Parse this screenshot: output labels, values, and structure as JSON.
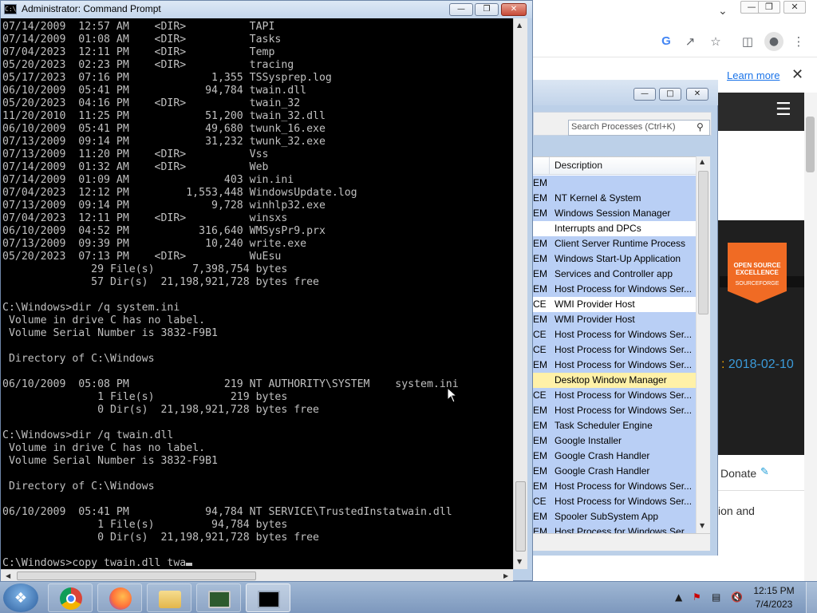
{
  "cmd_window": {
    "title": "Administrator: Command Prompt",
    "icon": "C:\\",
    "console_lines": [
      "07/14/2009  12:57 AM    <DIR>          TAPI",
      "07/14/2009  01:08 AM    <DIR>          Tasks",
      "07/04/2023  12:11 PM    <DIR>          Temp",
      "05/20/2023  02:23 PM    <DIR>          tracing",
      "05/17/2023  07:16 PM             1,355 TSSysprep.log",
      "06/10/2009  05:41 PM            94,784 twain.dll",
      "05/20/2023  04:16 PM    <DIR>          twain_32",
      "11/20/2010  11:25 PM            51,200 twain_32.dll",
      "06/10/2009  05:41 PM            49,680 twunk_16.exe",
      "07/13/2009  09:14 PM            31,232 twunk_32.exe",
      "07/13/2009  11:20 PM    <DIR>          Vss",
      "07/14/2009  01:32 AM    <DIR>          Web",
      "07/14/2009  01:09 AM               403 win.ini",
      "07/04/2023  12:12 PM         1,553,448 WindowsUpdate.log",
      "07/13/2009  09:14 PM             9,728 winhlp32.exe",
      "07/04/2023  12:11 PM    <DIR>          winsxs",
      "06/10/2009  04:52 PM           316,640 WMSysPr9.prx",
      "07/13/2009  09:39 PM            10,240 write.exe",
      "05/20/2023  07:13 PM    <DIR>          WuEsu",
      "              29 File(s)      7,398,754 bytes",
      "              57 Dir(s)  21,198,921,728 bytes free",
      "",
      "C:\\Windows>dir /q system.ini",
      " Volume in drive C has no label.",
      " Volume Serial Number is 3832-F9B1",
      "",
      " Directory of C:\\Windows",
      "",
      "06/10/2009  05:08 PM               219 NT AUTHORITY\\SYSTEM    system.ini",
      "               1 File(s)            219 bytes",
      "               0 Dir(s)  21,198,921,728 bytes free",
      "",
      "C:\\Windows>dir /q twain.dll",
      " Volume in drive C has no label.",
      " Volume Serial Number is 3832-F9B1",
      "",
      " Directory of C:\\Windows",
      "",
      "06/10/2009  05:41 PM            94,784 NT SERVICE\\TrustedInstatwain.dll",
      "               1 File(s)         94,784 bytes",
      "               0 Dir(s)  21,198,921,728 bytes free",
      "",
      "C:\\Windows>copy twain.dll twa"
    ]
  },
  "chrome": {
    "learn_more": "Learn more",
    "badge_line1": "OPEN SOURCE",
    "badge_line2": "EXCELLENCE",
    "badge_sf": "SOURCEFORGE",
    "date_text": "2018-02-10",
    "donate": "Donate",
    "ion_and": "ion and",
    "google_g": "G"
  },
  "procexp": {
    "search_placeholder": "Search Processes (Ctrl+K)",
    "column_description": "Description",
    "colors": {
      "blue": "#b9cff5",
      "pink": "#f1c6ea",
      "yellow": "#fff1a8",
      "white": "#ffffff"
    },
    "rows": [
      {
        "pfx": "EM",
        "desc": "",
        "color": "blue"
      },
      {
        "pfx": "EM",
        "desc": "NT Kernel & System",
        "color": "blue"
      },
      {
        "pfx": "EM",
        "desc": "Windows Session Manager",
        "color": "blue"
      },
      {
        "pfx": "",
        "desc": "Interrupts and DPCs",
        "color": "white"
      },
      {
        "pfx": "EM",
        "desc": "Client Server Runtime Process",
        "color": "blue"
      },
      {
        "pfx": "EM",
        "desc": "Windows Start-Up Application",
        "color": "blue"
      },
      {
        "pfx": "EM",
        "desc": "Services and Controller app",
        "color": "blue"
      },
      {
        "pfx": "EM",
        "desc": "Host Process for Windows Ser...",
        "color": "blue"
      },
      {
        "pfx": "CE",
        "desc": "WMI Provider Host",
        "color": "white"
      },
      {
        "pfx": "EM",
        "desc": "WMI Provider Host",
        "color": "blue"
      },
      {
        "pfx": "CE",
        "desc": "Host Process for Windows Ser...",
        "color": "blue"
      },
      {
        "pfx": "CE",
        "desc": "Host Process for Windows Ser...",
        "color": "blue"
      },
      {
        "pfx": "EM",
        "desc": "Host Process for Windows Ser...",
        "color": "blue"
      },
      {
        "pfx": "",
        "desc": "Desktop Window Manager",
        "color": "yellow"
      },
      {
        "pfx": "CE",
        "desc": "Host Process for Windows Ser...",
        "color": "blue"
      },
      {
        "pfx": "EM",
        "desc": "Host Process for Windows Ser...",
        "color": "blue"
      },
      {
        "pfx": "EM",
        "desc": "Task Scheduler Engine",
        "color": "blue"
      },
      {
        "pfx": "EM",
        "desc": "Google Installer",
        "color": "blue"
      },
      {
        "pfx": "EM",
        "desc": "Google Crash Handler",
        "color": "blue"
      },
      {
        "pfx": "EM",
        "desc": "Google Crash Handler",
        "color": "blue"
      },
      {
        "pfx": "EM",
        "desc": "Host Process for Windows Ser...",
        "color": "blue"
      },
      {
        "pfx": "CE",
        "desc": "Host Process for Windows Ser...",
        "color": "blue"
      },
      {
        "pfx": "EM",
        "desc": "Spooler SubSystem App",
        "color": "blue"
      },
      {
        "pfx": "EM",
        "desc": "Host Process for Windows Ser...",
        "color": "blue"
      }
    ]
  },
  "taskbar": {
    "apps": [
      "chrome-icon",
      "firefox-icon",
      "file-explorer-icon",
      "process-explorer-icon",
      "command-prompt-icon"
    ],
    "clock_time": "12:15 PM",
    "clock_date": "7/4/2023"
  }
}
